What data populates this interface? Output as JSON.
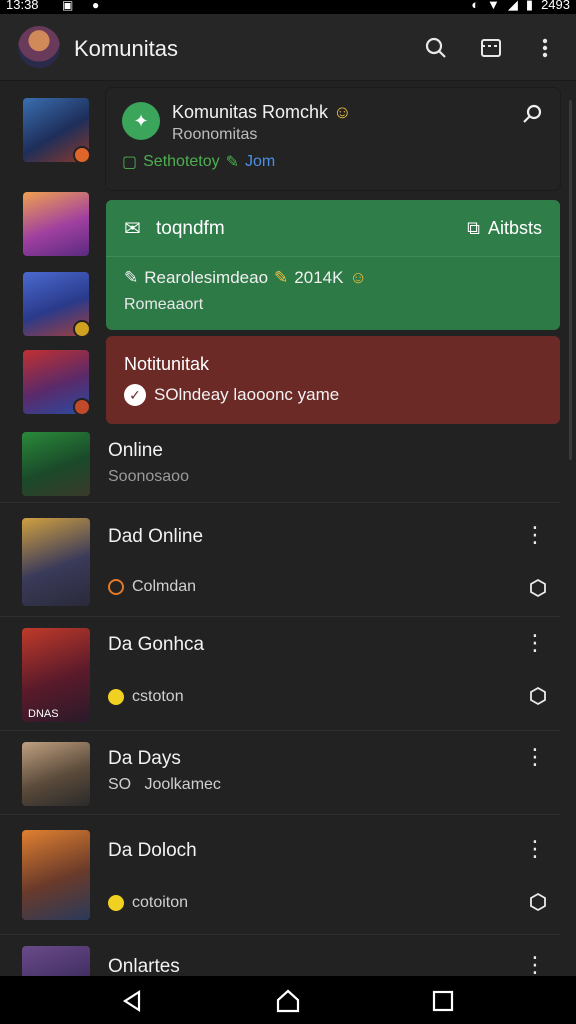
{
  "status_bar": {
    "time": "13:38",
    "battery": "2493"
  },
  "app_bar": {
    "title": "Komunitas"
  },
  "cards": {
    "community": {
      "title": "Komunitas Romchk",
      "subtitle": "Roonomitas",
      "line_text": "Sethotetoy",
      "join_label": "Jom"
    },
    "green": {
      "header_label": "toqndfm",
      "right_label": "Aitbsts",
      "line1": "Rearolesimdeao",
      "line1_count": "2014K",
      "line2": "Romeaaort"
    },
    "notification": {
      "title": "Notitunitak",
      "line": "SOlndeay laooonc yame"
    }
  },
  "list": [
    {
      "name": "Online",
      "meta": "Soonosaoo"
    },
    {
      "name": "Dad Online",
      "meta": "Colmdan"
    },
    {
      "name": "Da Gonhca",
      "meta": "cstoton",
      "thumb_text": "DNAS"
    },
    {
      "name": "Da Days",
      "meta": "SO   Joolkamec"
    },
    {
      "name": "Da Doloch",
      "meta": "cotoiton"
    },
    {
      "name": "Onlartes",
      "meta": ""
    }
  ],
  "icons": {
    "search": "search-icon",
    "grid": "grid-icon",
    "more": "more-vert-icon",
    "back": "back-icon",
    "home": "home-icon",
    "recents": "recents-icon"
  },
  "colors": {
    "background": "#222222",
    "green_card": "#2e7a47",
    "red_card": "#6b2a26",
    "accent_green": "#3aa55b",
    "join_blue": "#4a90e2"
  }
}
